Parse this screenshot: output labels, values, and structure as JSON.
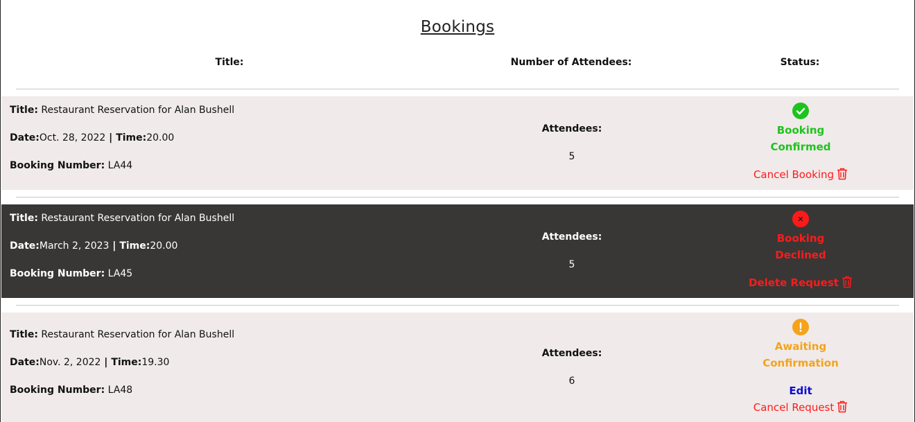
{
  "page": {
    "title": "Bookings",
    "headers": {
      "title": "Title:",
      "attendees": "Number of Attendees:",
      "status": "Status:"
    }
  },
  "colors": {
    "confirmed": "#1ec31e",
    "declined": "#ff1a1a",
    "awaiting": "#f5a31a",
    "edit": "#0b0bd6"
  },
  "bookings": [
    {
      "title_label": "Title:",
      "title": "Restaurant Reservation for Alan Bushell",
      "date_label": "Date:",
      "date": "Oct. 28, 2022",
      "sep": " | ",
      "time_label": "Time:",
      "time": "20.00",
      "number_label": "Booking Number:",
      "number": "LA44",
      "attendees_label": "Attendees:",
      "attendees": "5",
      "status_line1": "Booking",
      "status_line2": "Confirmed",
      "status_icon": "check-circle-icon",
      "action": "Cancel Booking"
    },
    {
      "title_label": "Title:",
      "title": "Restaurant Reservation for Alan Bushell",
      "date_label": "Date:",
      "date": "March 2, 2023",
      "sep": " | ",
      "time_label": "Time:",
      "time": "20.00",
      "number_label": "Booking Number:",
      "number": "LA45",
      "attendees_label": "Attendees:",
      "attendees": "5",
      "status_line1": "Booking",
      "status_line2": "Declined",
      "status_icon": "x-circle-icon",
      "action": "Delete Request"
    },
    {
      "title_label": "Title:",
      "title": "Restaurant Reservation for Alan Bushell",
      "date_label": "Date:",
      "date": "Nov. 2, 2022",
      "sep": " | ",
      "time_label": "Time:",
      "time": "19.30",
      "number_label": "Booking Number:",
      "number": "LA48",
      "attendees_label": "Attendees:",
      "attendees": "6",
      "status_line1": "Awaiting",
      "status_line2": "Confirmation",
      "status_icon": "exclamation-circle-icon",
      "edit": "Edit",
      "action": "Cancel Request"
    }
  ]
}
